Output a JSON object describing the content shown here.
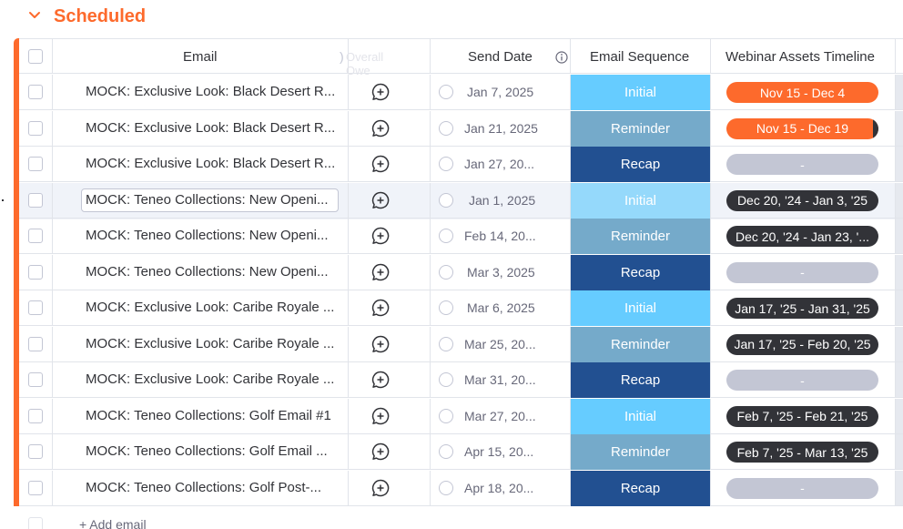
{
  "group": {
    "title": "Scheduled"
  },
  "columns": {
    "email": "Email",
    "ghost_text": "Overall Owe",
    "ghost_paren": ")",
    "send_date": "Send Date",
    "email_sequence": "Email Sequence",
    "timeline": "Webinar Assets Timeline"
  },
  "colors": {
    "accent": "#fd6a2c",
    "initial": "#66ccff",
    "initial_selected": "#95d9fb",
    "reminder": "#75aaca",
    "recap": "#225091",
    "timeline_orange": "#fd6a2c",
    "timeline_dark": "#323338",
    "timeline_empty": "#c3c6d4"
  },
  "rows": [
    {
      "email": "MOCK: Exclusive Look: Black Desert R...",
      "date": "Jan 7, 2025",
      "sequence": "Initial",
      "timeline": "Nov 15 - Dec 4"
    },
    {
      "email": "MOCK: Exclusive Look: Black Desert R...",
      "date": "Jan 21, 2025",
      "sequence": "Reminder",
      "timeline": "Nov 15 - Dec 19"
    },
    {
      "email": "MOCK: Exclusive Look: Black Desert R...",
      "date": "Jan 27, 20...",
      "sequence": "Recap",
      "timeline": "-"
    },
    {
      "email": "MOCK: Teneo Collections: New Openi...",
      "date": "Jan 1, 2025",
      "sequence": "Initial",
      "timeline": "Dec 20, '24 - Jan 3, '25"
    },
    {
      "email": "MOCK: Teneo Collections: New Openi...",
      "date": "Feb 14, 20...",
      "sequence": "Reminder",
      "timeline": "Dec 20, '24 - Jan 23, '..."
    },
    {
      "email": "MOCK: Teneo Collections: New Openi...",
      "date": "Mar 3, 2025",
      "sequence": "Recap",
      "timeline": "-"
    },
    {
      "email": "MOCK: Exclusive Look: Caribe Royale ...",
      "date": "Mar 6, 2025",
      "sequence": "Initial",
      "timeline": "Jan 17, '25 - Jan 31, '25"
    },
    {
      "email": "MOCK: Exclusive Look: Caribe Royale ...",
      "date": "Mar 25, 20...",
      "sequence": "Reminder",
      "timeline": "Jan 17, '25 - Feb 20, '25"
    },
    {
      "email": "MOCK: Exclusive Look: Caribe Royale ...",
      "date": "Mar 31, 20...",
      "sequence": "Recap",
      "timeline": "-"
    },
    {
      "email": "MOCK: Teneo Collections: Golf Email #1",
      "date": "Mar 27, 20...",
      "sequence": "Initial",
      "timeline": "Feb 7, '25 - Feb 21, '25"
    },
    {
      "email": "MOCK: Teneo Collections: Golf Email ...",
      "date": "Apr 15, 20...",
      "sequence": "Reminder",
      "timeline": "Feb 7, '25 - Mar 13, '25"
    },
    {
      "email": "MOCK: Teneo Collections: Golf Post-...",
      "date": "Apr 18, 20...",
      "sequence": "Recap",
      "timeline": "-"
    }
  ],
  "add_row_label": "+ Add email"
}
